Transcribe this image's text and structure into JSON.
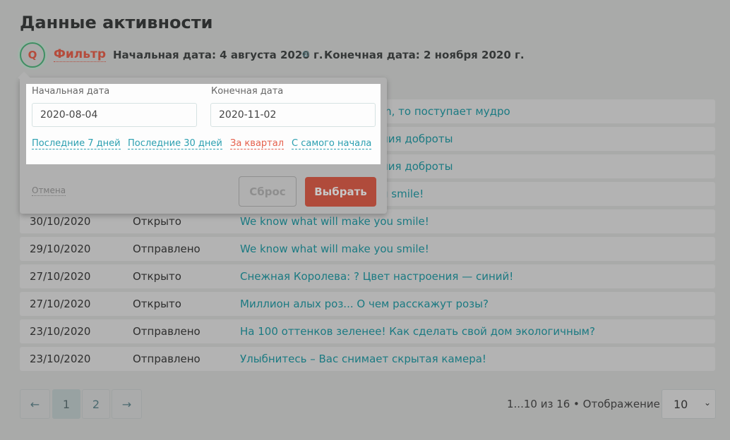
{
  "title": "Данные активности",
  "filter": {
    "label": "Фильтр",
    "start_chip": "Начальная дата: 4 августа 2020 г.",
    "end_chip": "Конечная дата: 2 ноября 2020 г.",
    "clear_icon": "⊗"
  },
  "popup": {
    "start_label": "Начальная дата",
    "start_value": "2020-08-04",
    "end_label": "Конечная дата",
    "end_value": "2020-11-02",
    "quick": [
      "Последние 7 дней",
      "Последние 30 дней",
      "За квартал",
      "С самого начала"
    ],
    "cancel": "Отмена",
    "reset": "Сброс",
    "select": "Выбрать"
  },
  "rows": [
    {
      "date": "",
      "status": "",
      "subject": "m, то поступает мудро"
    },
    {
      "date": "",
      "status": "",
      "subject": "ния доброты"
    },
    {
      "date": "",
      "status": "",
      "subject": "ния доброты"
    },
    {
      "date": "",
      "status": "",
      "subject": "u smile!"
    },
    {
      "date": "30/10/2020",
      "status": "Открыто",
      "subject": "We know what will make you smile!"
    },
    {
      "date": "29/10/2020",
      "status": "Отправлено",
      "subject": "We know what will make you smile!"
    },
    {
      "date": "27/10/2020",
      "status": "Открыто",
      "subject": "Снежная Королева: ? Цвет настроения — синий!"
    },
    {
      "date": "27/10/2020",
      "status": "Открыто",
      "subject": "Миллион алых роз... О чем расскажут розы?"
    },
    {
      "date": "23/10/2020",
      "status": "Отправлено",
      "subject": "На 100 оттенков зеленее! Как сделать свой дом экологичным?"
    },
    {
      "date": "23/10/2020",
      "status": "Отправлено",
      "subject": "Улыбнитесь – Вас снимает скрытая камера!"
    }
  ],
  "pagination": {
    "prev": "←",
    "pages": [
      "1",
      "2"
    ],
    "next": "→",
    "info": "1...10 из 16 • Отображение",
    "per_page": "10"
  }
}
